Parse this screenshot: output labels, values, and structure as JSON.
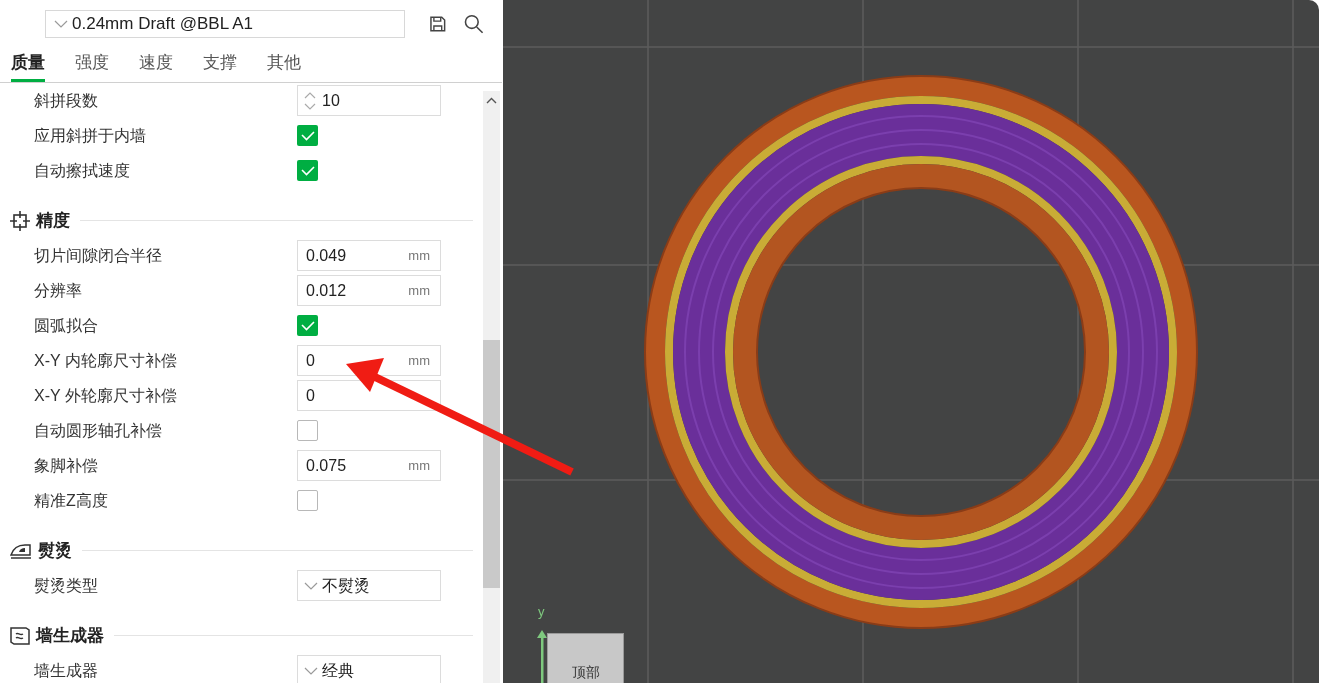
{
  "preset": {
    "value": "0.24mm Draft @BBL A1"
  },
  "tabs": [
    {
      "label": "质量",
      "selected": true
    },
    {
      "label": "强度",
      "selected": false
    },
    {
      "label": "速度",
      "selected": false
    },
    {
      "label": "支撑",
      "selected": false
    },
    {
      "label": "其他",
      "selected": false
    }
  ],
  "groups": [
    {
      "rows": [
        {
          "kind": "spin",
          "label": "斜拼段数",
          "value": "10"
        },
        {
          "kind": "checkbox",
          "label": "应用斜拼于内墙",
          "checked": true
        },
        {
          "kind": "checkbox",
          "label": "自动擦拭速度",
          "checked": true
        }
      ]
    },
    {
      "title": "精度",
      "rows": [
        {
          "kind": "number",
          "label": "切片间隙闭合半径",
          "value": "0.049",
          "unit": "mm"
        },
        {
          "kind": "number",
          "label": "分辨率",
          "value": "0.012",
          "unit": "mm"
        },
        {
          "kind": "checkbox",
          "label": "圆弧拟合",
          "checked": true
        },
        {
          "kind": "number",
          "label": "X-Y 内轮廓尺寸补偿",
          "value": "0",
          "unit": "mm"
        },
        {
          "kind": "number",
          "label": "X-Y 外轮廓尺寸补偿",
          "value": "0"
        },
        {
          "kind": "checkbox",
          "label": "自动圆形轴孔补偿",
          "checked": false
        },
        {
          "kind": "number",
          "label": "象脚补偿",
          "value": "0.075",
          "unit": "mm"
        },
        {
          "kind": "checkbox",
          "label": "精准Z高度",
          "checked": false
        }
      ]
    },
    {
      "title": "熨烫",
      "rows": [
        {
          "kind": "dropdown",
          "label": "熨烫类型",
          "value": "不熨烫"
        }
      ]
    },
    {
      "title": "墙生成器",
      "rows": [
        {
          "kind": "dropdown",
          "label": "墙生成器",
          "value": "经典"
        }
      ]
    }
  ],
  "viewport": {
    "axis_label": "y",
    "view_cube_label": "顶部"
  }
}
